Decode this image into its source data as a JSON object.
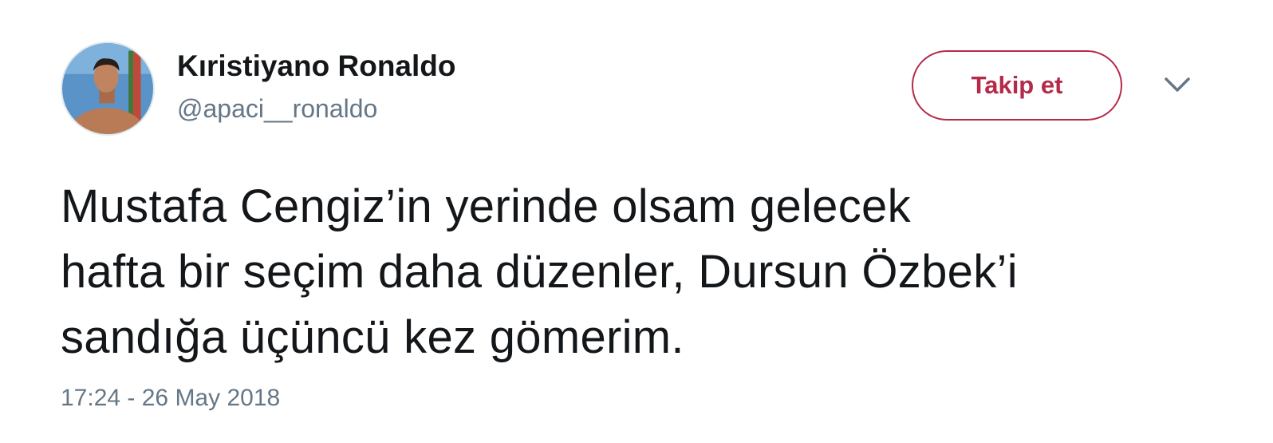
{
  "user": {
    "display_name": "Kıristiyano Ronaldo",
    "handle": "@apaci__ronaldo"
  },
  "follow_button": {
    "label": "Takip et"
  },
  "menu": {
    "icon": "chevron-down-icon"
  },
  "tweet": {
    "lines": [
      "Mustafa Cengiz’in yerinde olsam gelecek",
      "hafta bir seçim daha düzenler, Dursun Özbek’i",
      "sandığa üçüncü kez gömerim."
    ],
    "timestamp": "17:24 - 26 May 2018"
  },
  "colors": {
    "accent": "#b52a4a",
    "text": "#14171a",
    "secondary": "#657786"
  }
}
